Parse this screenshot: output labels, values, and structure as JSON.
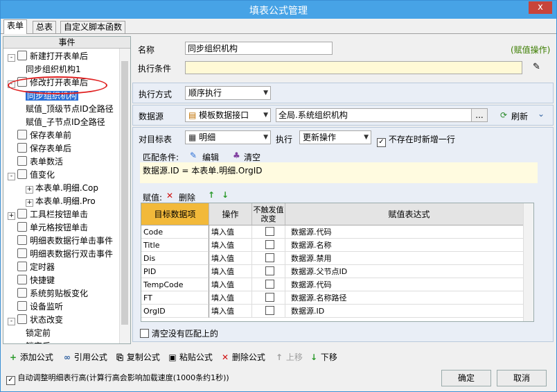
{
  "window": {
    "title": "填表公式管理",
    "close": "x"
  },
  "tabs": [
    "表单",
    "总表",
    "自定义脚本函数"
  ],
  "tree": {
    "header": "事件",
    "items": [
      {
        "label": "新建打开表单后",
        "level": 0,
        "exp": "-"
      },
      {
        "label": "同步组织机构1",
        "level": 1
      },
      {
        "label": "修改打开表单后",
        "level": 0,
        "exp": "-"
      },
      {
        "label": "同步组织机构",
        "level": 1,
        "selected": true
      },
      {
        "label": "赋值_顶级节点ID全路径",
        "level": 1
      },
      {
        "label": "赋值_子节点ID全路径",
        "level": 1
      },
      {
        "label": "保存表单前",
        "level": 0
      },
      {
        "label": "保存表单后",
        "level": 0
      },
      {
        "label": "表单数活",
        "level": 0
      },
      {
        "label": "值变化",
        "level": 0,
        "exp": "-"
      },
      {
        "label": "本表单.明细.Cop",
        "level": 1,
        "exp": "+"
      },
      {
        "label": "本表单.明细.Pro",
        "level": 1,
        "exp": "+"
      },
      {
        "label": "工具栏按钮单击",
        "level": 0,
        "exp": "+"
      },
      {
        "label": "单元格按钮单击",
        "level": 0
      },
      {
        "label": "明细表数据行单击事件",
        "level": 0
      },
      {
        "label": "明细表数据行双击事件",
        "level": 0
      },
      {
        "label": "定时器",
        "level": 0
      },
      {
        "label": "快捷键",
        "level": 0
      },
      {
        "label": "系统剪贴板变化",
        "level": 0
      },
      {
        "label": "设备监听",
        "level": 0
      },
      {
        "label": "状态改变",
        "level": 0,
        "exp": "-"
      },
      {
        "label": "锁定前",
        "level": 1
      },
      {
        "label": "锁定后",
        "level": 1
      }
    ]
  },
  "form": {
    "name_label": "名称",
    "name_value": "同步组织机构",
    "assign_op_link": "(赋值操作)",
    "condition_label": "执行条件",
    "condition_value": "",
    "exec_mode_label": "执行方式",
    "exec_mode_value": "顺序执行",
    "datasource_label": "数据源",
    "datasource_type": "模板数据接口",
    "datasource_path": "全局.系统组织机构",
    "browse": "...",
    "refresh": "刷新",
    "target_label": "对目标表",
    "target_value": "明细",
    "execute_label": "执行",
    "execute_value": "更新操作",
    "insert_if_missing": "不存在时新增一行",
    "match_label": "匹配条件:",
    "edit_label": "编辑",
    "clear_label": "清空",
    "match_expr": "数据源.ID = 本表单.明细.OrgID",
    "assign_label": "赋值:",
    "delete_label": "删除",
    "clear_unmatched": "清空没有匹配上的"
  },
  "grid": {
    "headers": [
      "目标数据项",
      "操作",
      "不触发值改变",
      "赋值表达式"
    ],
    "rows": [
      [
        "Code",
        "填入值",
        "数据源.代码"
      ],
      [
        "Title",
        "填入值",
        "数据源.名称"
      ],
      [
        "Dis",
        "填入值",
        "数据源.禁用"
      ],
      [
        "PID",
        "填入值",
        "数据源.父节点ID"
      ],
      [
        "TempCode",
        "填入值",
        "数据源.代码"
      ],
      [
        "FT",
        "填入值",
        "数据源.名称路径"
      ],
      [
        "OrgID",
        "填入值",
        "数据源.ID"
      ]
    ]
  },
  "toolbar": {
    "add": "添加公式",
    "ref": "引用公式",
    "copy": "复制公式",
    "paste": "粘贴公式",
    "delete": "删除公式",
    "up": "上移",
    "down": "下移"
  },
  "footer": {
    "auto_adjust": "自动调整明细表行高(计算行高会影响加载速度(1000条约1秒))",
    "ok": "确定",
    "cancel": "取消"
  },
  "colors": {
    "titlebar": "#47a3e6",
    "selection": "#2a6fd6",
    "target_header": "#f2b93a",
    "highlight_ellipse": "#e02020"
  }
}
